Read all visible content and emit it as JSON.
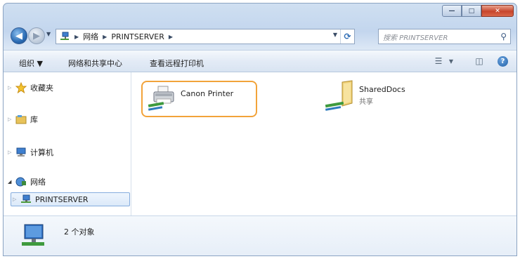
{
  "window": {
    "caption": {
      "minimize": "—",
      "maximize": "□",
      "close": "✕"
    }
  },
  "address": {
    "crumbs": [
      "网络",
      "PRINTSERVER"
    ],
    "search_placeholder": "搜索 PRINTSERVER"
  },
  "toolbar": {
    "organize": "组织 ▼",
    "network_center": "网络和共享中心",
    "view_printers": "查看远程打印机"
  },
  "navigation": {
    "items": [
      {
        "label": "收藏夹",
        "icon": "star-icon"
      },
      {
        "label": "库",
        "icon": "library-icon"
      },
      {
        "label": "计算机",
        "icon": "computer-icon"
      },
      {
        "label": "网络",
        "icon": "network-icon"
      },
      {
        "label": "PRINTSERVER",
        "icon": "server-icon",
        "selected": true
      }
    ]
  },
  "files": [
    {
      "name": "Canon Printer",
      "sub": "",
      "icon": "printer-icon",
      "highlighted": true
    },
    {
      "name": "SharedDocs",
      "sub": "共享",
      "icon": "shared-folder-icon"
    }
  ],
  "details": {
    "count_text": "2 个对象"
  },
  "colors": {
    "highlight": "#f2a33a",
    "selection": "#84acdd"
  }
}
